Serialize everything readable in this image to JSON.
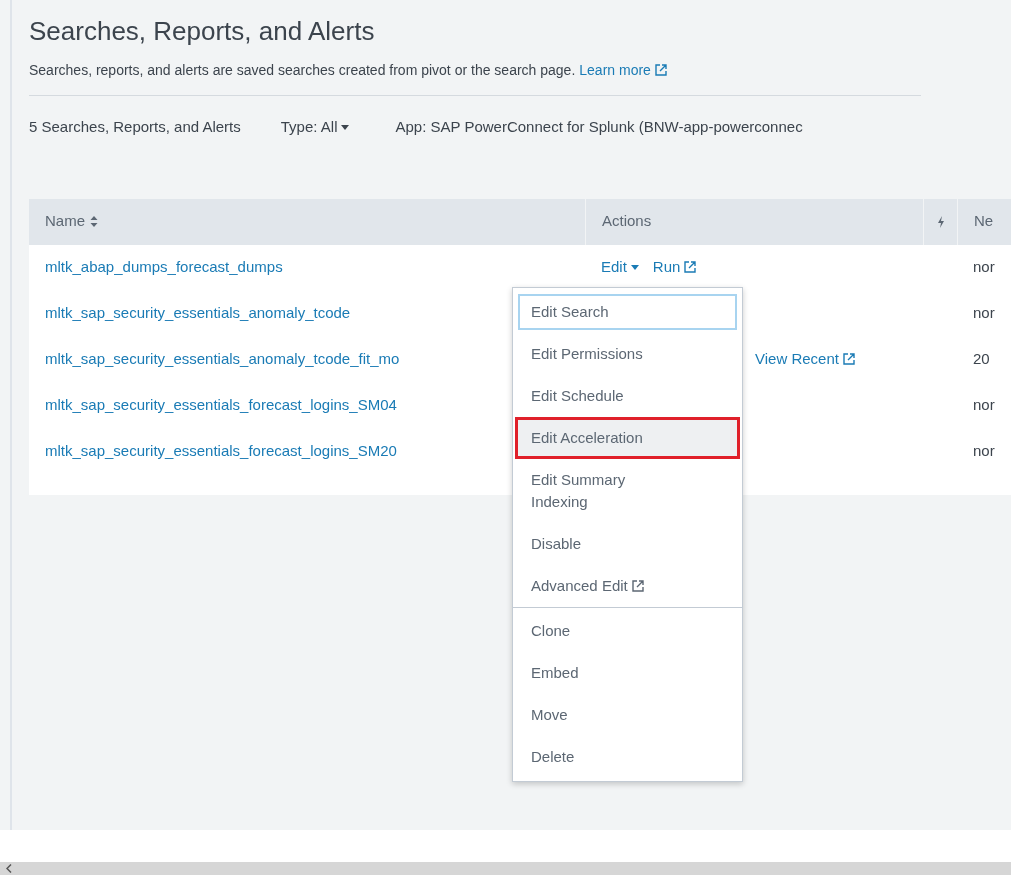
{
  "page": {
    "title": "Searches, Reports, and Alerts",
    "description": "Searches, reports, and alerts are saved searches created from pivot or the search page.",
    "learn_more": "Learn more"
  },
  "filters": {
    "count": "5 Searches, Reports, and Alerts",
    "type": "Type: All",
    "app": "App: SAP PowerConnect for Splunk (BNW-app-powerconnec"
  },
  "table": {
    "columns": [
      {
        "label": "Name",
        "sortable": true
      },
      {
        "label": "Actions",
        "sortable": false
      },
      {
        "kind": "icon"
      },
      {
        "label": "Ne",
        "sortable": false
      }
    ],
    "rows": [
      {
        "name": "mltk_abap_dumps_forecast_dumps",
        "actions": [
          {
            "label": "Edit",
            "kind": "dropdown"
          },
          {
            "label": "Run",
            "kind": "external"
          }
        ],
        "column_4": "nor"
      },
      {
        "name": "mltk_sap_security_essentials_anomaly_tcode",
        "actions": [],
        "column_4": "nor"
      },
      {
        "name": "mltk_sap_security_essentials_anomaly_tcode_fit_mo",
        "actions": [
          {
            "label": "View Recent",
            "kind": "external"
          }
        ],
        "column_4": "20"
      },
      {
        "name": "mltk_sap_security_essentials_forecast_logins_SM04",
        "actions": [],
        "column_4": "nor"
      },
      {
        "name": "mltk_sap_security_essentials_forecast_logins_SM20",
        "actions": [],
        "column_4": "nor"
      }
    ]
  },
  "edit_menu": {
    "groups": [
      [
        {
          "label": "Edit Search",
          "focused": true,
          "hovered": false,
          "outlined": false,
          "external": false
        },
        {
          "label": "Edit Permissions",
          "focused": false,
          "hovered": false,
          "outlined": false,
          "external": false
        },
        {
          "label": "Edit Schedule",
          "focused": false,
          "hovered": false,
          "outlined": false,
          "external": false
        },
        {
          "label": "Edit Acceleration",
          "focused": false,
          "hovered": true,
          "outlined": true,
          "external": false
        },
        {
          "label": "Edit Summary Indexing",
          "focused": false,
          "hovered": false,
          "outlined": false,
          "external": false
        },
        {
          "label": "Disable",
          "focused": false,
          "hovered": false,
          "outlined": false,
          "external": false
        },
        {
          "label": "Advanced Edit",
          "focused": false,
          "hovered": false,
          "outlined": false,
          "external": true
        }
      ],
      [
        {
          "label": "Clone",
          "focused": false,
          "hovered": false,
          "outlined": false,
          "external": false
        },
        {
          "label": "Embed",
          "focused": false,
          "hovered": false,
          "outlined": false,
          "external": false
        },
        {
          "label": "Move",
          "focused": false,
          "hovered": false,
          "outlined": false,
          "external": false
        },
        {
          "label": "Delete",
          "focused": false,
          "hovered": false,
          "outlined": false,
          "external": false
        }
      ]
    ]
  }
}
